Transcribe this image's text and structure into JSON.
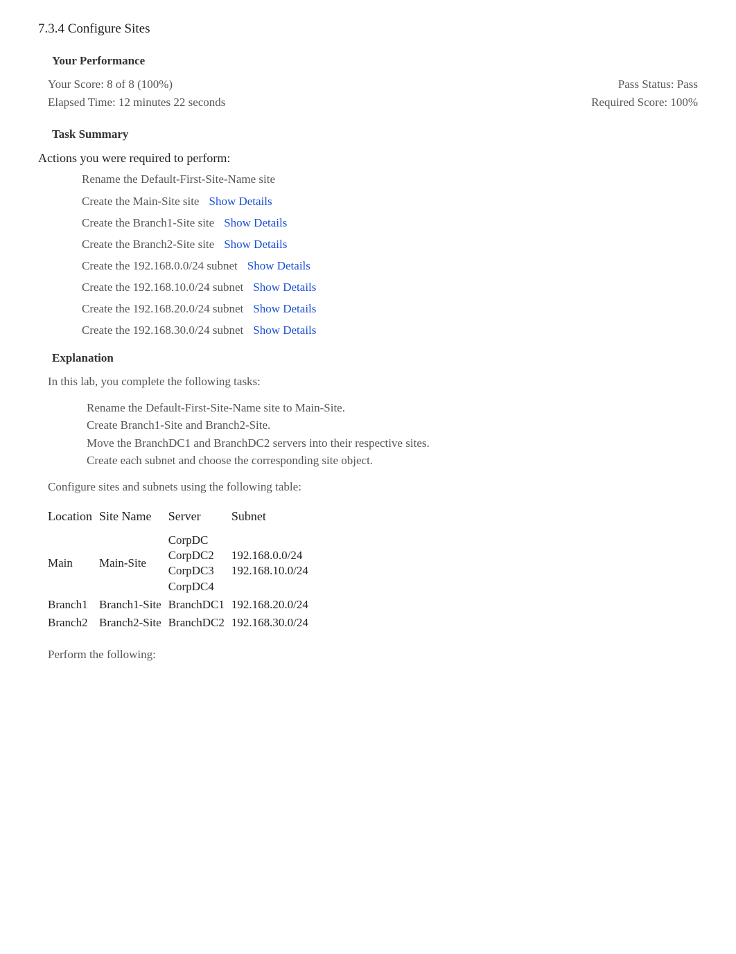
{
  "title": "7.3.4 Configure Sites",
  "performance": {
    "heading": "Your Performance",
    "score_label": "Your Score: 8 of 8 (100%)",
    "elapsed_label": "Elapsed Time: 12 minutes 22 seconds",
    "pass_status": "Pass Status: Pass",
    "required_score": "Required Score: 100%"
  },
  "task_summary": {
    "heading": "Task Summary",
    "intro": "Actions you were required to perform:",
    "show_details": "Show Details",
    "tasks": [
      {
        "text": "Rename the Default-First-Site-Name site",
        "has_link": false
      },
      {
        "text": "Create the Main-Site site",
        "has_link": true
      },
      {
        "text": "Create the Branch1-Site site",
        "has_link": true
      },
      {
        "text": "Create the Branch2-Site site",
        "has_link": true
      },
      {
        "text": "Create the 192.168.0.0/24 subnet",
        "has_link": true
      },
      {
        "text": "Create the 192.168.10.0/24 subnet",
        "has_link": true
      },
      {
        "text": "Create the 192.168.20.0/24 subnet",
        "has_link": true
      },
      {
        "text": "Create the 192.168.30.0/24 subnet",
        "has_link": true
      }
    ]
  },
  "explanation": {
    "heading": "Explanation",
    "intro": "In this lab, you complete the following tasks:",
    "bullets": [
      "Rename the Default-First-Site-Name site to Main-Site.",
      "Create Branch1-Site and Branch2-Site.",
      "Move the BranchDC1 and BranchDC2 servers into their respective sites.",
      "Create each subnet and choose the corresponding site object."
    ],
    "table_intro": "Configure sites and subnets using the following table:",
    "table": {
      "headers": [
        "Location",
        "Site Name",
        "Server",
        "Subnet"
      ],
      "rows": [
        {
          "location": "Main",
          "site": "Main-Site",
          "server": "CorpDC\nCorpDC2\nCorpDC3\nCorpDC4",
          "subnet": "192.168.0.0/24\n192.168.10.0/24"
        },
        {
          "location": "Branch1",
          "site": "Branch1-Site",
          "server": "BranchDC1",
          "subnet": "192.168.20.0/24"
        },
        {
          "location": "Branch2",
          "site": "Branch2-Site",
          "server": "BranchDC2",
          "subnet": "192.168.30.0/24"
        }
      ]
    },
    "perform": "Perform the following:"
  }
}
